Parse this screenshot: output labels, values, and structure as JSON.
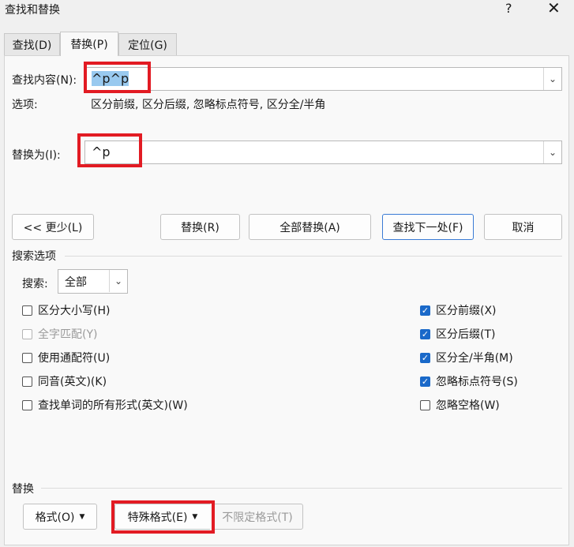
{
  "window": {
    "title": "查找和替换",
    "help": "?",
    "close": "✕"
  },
  "tabs": [
    {
      "label": "查找(D)"
    },
    {
      "label": "替换(P)"
    },
    {
      "label": "定位(G)"
    }
  ],
  "find": {
    "label": "查找内容(N):",
    "value": "^p^p"
  },
  "options": {
    "label": "选项:",
    "value": "区分前缀, 区分后缀, 忽略标点符号, 区分全/半角"
  },
  "replace": {
    "label": "替换为(I):",
    "value": "^p"
  },
  "buttons": {
    "less": "<< 更少(L)",
    "replace": "替换(R)",
    "replace_all": "全部替换(A)",
    "find_next": "查找下一处(F)",
    "cancel": "取消"
  },
  "search_options": {
    "title": "搜索选项",
    "search_label": "搜索:",
    "search_value": "全部",
    "left": [
      {
        "label": "区分大小写(H)",
        "checked": false,
        "disabled": false
      },
      {
        "label": "全字匹配(Y)",
        "checked": false,
        "disabled": true
      },
      {
        "label": "使用通配符(U)",
        "checked": false,
        "disabled": false
      },
      {
        "label": "同音(英文)(K)",
        "checked": false,
        "disabled": false
      },
      {
        "label": "查找单词的所有形式(英文)(W)",
        "checked": false,
        "disabled": false
      }
    ],
    "right": [
      {
        "label": "区分前缀(X)",
        "checked": true
      },
      {
        "label": "区分后缀(T)",
        "checked": true
      },
      {
        "label": "区分全/半角(M)",
        "checked": true
      },
      {
        "label": "忽略标点符号(S)",
        "checked": true
      },
      {
        "label": "忽略空格(W)",
        "checked": false
      }
    ]
  },
  "replace_section": {
    "title": "替换",
    "format": "格式(O)",
    "special": "特殊格式(E)",
    "no_format": "不限定格式(T)"
  },
  "colors": {
    "highlight": "#e21b23",
    "accent": "#1a69c9"
  }
}
